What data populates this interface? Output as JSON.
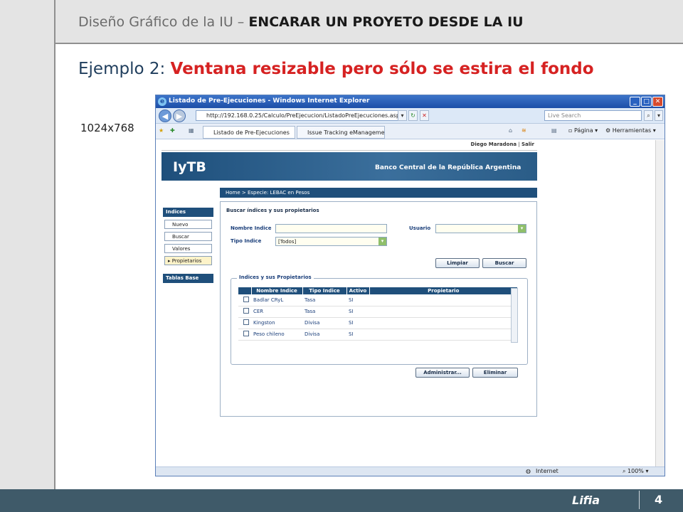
{
  "slide": {
    "header_prefix": "Diseño Gráfico de la IU –",
    "header_bold": "ENCARAR UN PROYETO DESDE LA IU",
    "subtitle_prefix": "Ejemplo 2:",
    "subtitle_highlight": "Ventana resizable pero sólo se estira el fondo",
    "resolution": "1024x768",
    "logo": "Lifia",
    "page_number": "4"
  },
  "browser": {
    "title": "Listado de Pre-Ejecuciones - Windows Internet Explorer",
    "url": "http://192.168.0.25/Calculo/PreEjecucion/ListadoPreEjecuciones.aspx",
    "search_placeholder": "Live Search",
    "tabs": [
      {
        "label": "Listado de Pre-Ejecuciones"
      },
      {
        "label": "Issue Tracking eManagement..."
      }
    ],
    "commands": {
      "page": "Página",
      "tools": "Herramientas"
    },
    "status": {
      "zone": "Internet",
      "zoom": "100%"
    }
  },
  "webpage": {
    "user": "Diego Maradona",
    "logout": "Salir",
    "logo": "IyTB",
    "bank": "Banco Central de la República Argentina",
    "breadcrumb": "Home > Especie: LEBAC en Pesos",
    "sidebar": {
      "section1": "Indices",
      "items": [
        {
          "label": "Nuevo"
        },
        {
          "label": "Buscar"
        },
        {
          "label": "Valores"
        },
        {
          "label": "Propietarios"
        }
      ],
      "section2": "Tablas Base"
    },
    "form": {
      "title": "Buscar índices y sus propietarios",
      "nombre_label": "Nombre Indice",
      "nombre_value": "",
      "usuario_label": "Usuario",
      "usuario_value": "",
      "tipo_label": "Tipo Indice",
      "tipo_value": "[Todos]",
      "btn_limpiar": "Limpiar",
      "btn_buscar": "Buscar"
    },
    "results": {
      "legend": "Indices y sus Propietarios",
      "columns": [
        "Nombre Indice",
        "Tipo Indice",
        "Activo",
        "Propietario"
      ],
      "rows": [
        {
          "nombre": "Badlar CRyL",
          "tipo": "Tasa",
          "activo": "SI",
          "propietario": ""
        },
        {
          "nombre": "CER",
          "tipo": "Tasa",
          "activo": "SI",
          "propietario": ""
        },
        {
          "nombre": "Kingston",
          "tipo": "Divisa",
          "activo": "SI",
          "propietario": ""
        },
        {
          "nombre": "Peso chileno",
          "tipo": "Divisa",
          "activo": "SI",
          "propietario": ""
        }
      ],
      "btn_administrar": "Administrar...",
      "btn_eliminar": "Eliminar"
    }
  }
}
